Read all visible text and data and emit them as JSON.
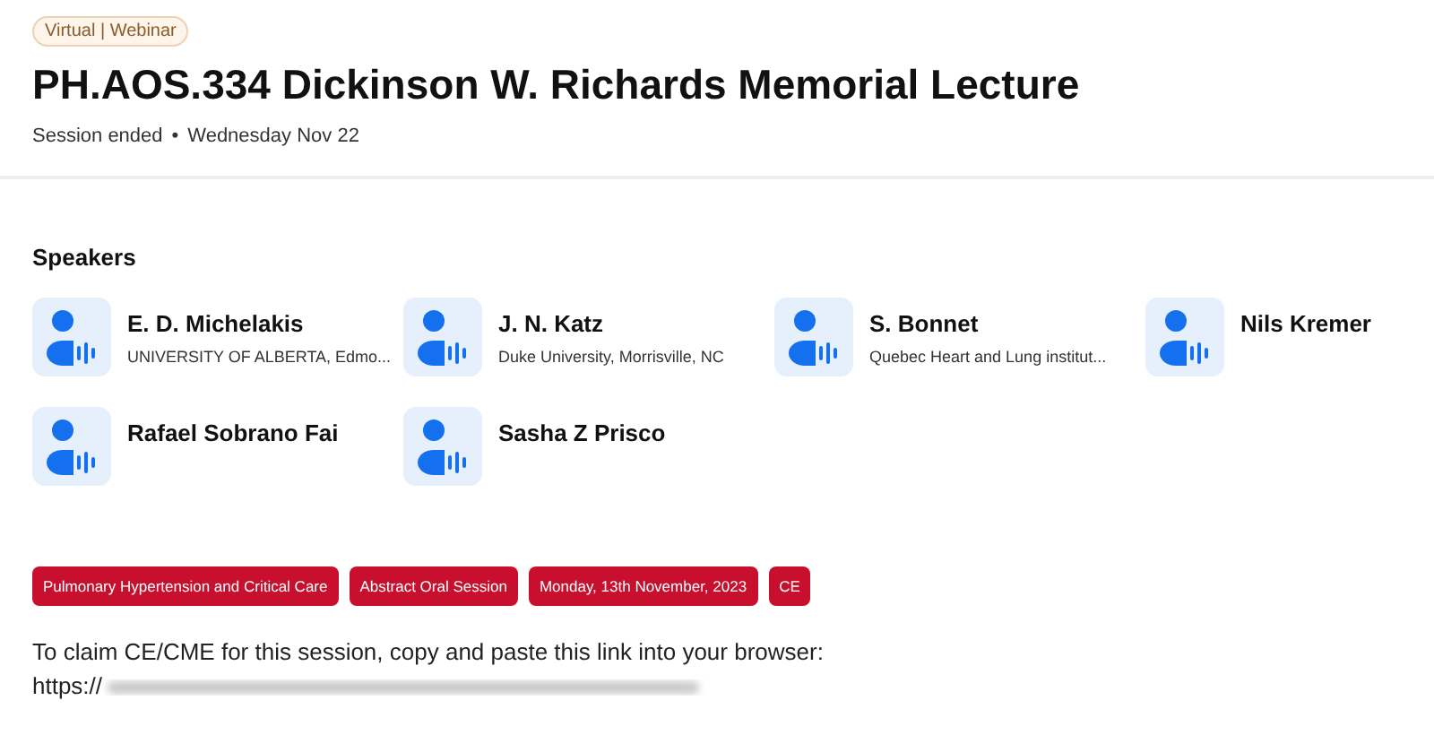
{
  "badge": "Virtual | Webinar",
  "title": "PH.AOS.334 Dickinson W. Richards Memorial Lecture",
  "status": "Session ended",
  "separator": "•",
  "date": "Wednesday Nov 22",
  "speakers_heading": "Speakers",
  "speakers": [
    {
      "name": "E. D. Michelakis",
      "affiliation": "UNIVERSITY OF ALBERTA, Edmo..."
    },
    {
      "name": "J. N. Katz",
      "affiliation": "Duke University, Morrisville, NC"
    },
    {
      "name": "S. Bonnet",
      "affiliation": "Quebec Heart and Lung institut..."
    },
    {
      "name": "Nils Kremer"
    },
    {
      "name": "Rafael Sobrano Fai"
    },
    {
      "name": "Sasha Z Prisco"
    }
  ],
  "tags": [
    "Pulmonary Hypertension and Critical Care",
    "Abstract Oral Session",
    "Monday, 13th November, 2023",
    "CE"
  ],
  "claim_text": "To claim CE/CME for this session, copy and paste this link into your browser:",
  "link_prefix": "https://"
}
